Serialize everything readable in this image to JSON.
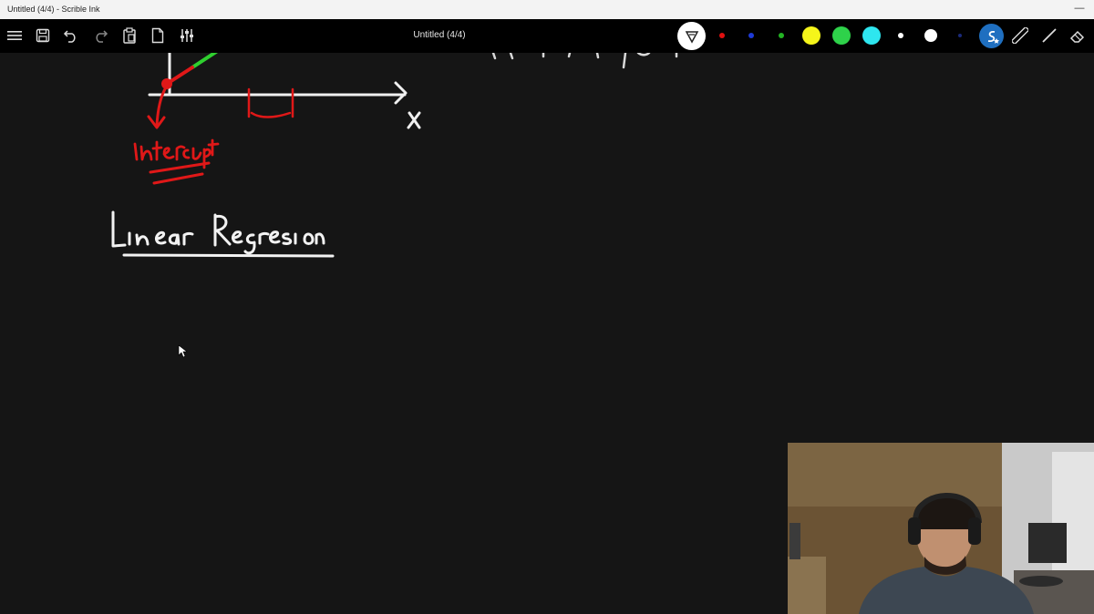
{
  "window": {
    "title": "Untitled (4/4) - Scrible Ink",
    "minimize_glyph": "—"
  },
  "toolbar": {
    "document_title": "Untitled (4/4)",
    "left_icons": [
      "menu-icon",
      "save-icon",
      "undo-icon",
      "redo-icon",
      "paste-icon",
      "new-page-icon",
      "settings-sliders-icon"
    ],
    "right_icons": [
      "pen-filter-icon",
      "smart-ink-icon",
      "ruler-icon",
      "line-icon",
      "eraser-icon"
    ],
    "colors": [
      "#e01010",
      "#1e3ad6",
      "#23b323",
      "#f5f51a",
      "#2ed24a",
      "#2ee6ef",
      "#ffffff",
      "#ffffff",
      "#1a2a7a"
    ]
  },
  "canvas": {
    "handwritten_heading": "Linear Regression",
    "axis_label": "x",
    "annotation": "intercept"
  }
}
